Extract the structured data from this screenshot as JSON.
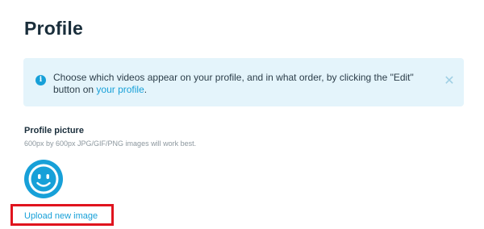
{
  "page": {
    "title": "Profile"
  },
  "banner": {
    "icon": "info-icon",
    "text": "Choose which videos appear on your profile, and in what order, by clicking the \"Edit\" button on ",
    "link_text": "your profile",
    "text_end": ".",
    "close_icon": "close-icon"
  },
  "profile_picture": {
    "heading": "Profile picture",
    "hint": "600px by 600px JPG/GIF/PNG images will work best.",
    "avatar_icon": "smiley-avatar-icon",
    "upload_label": "Upload new image"
  },
  "colors": {
    "accent": "#17a0d8",
    "banner_bg": "#e4f4fb",
    "highlight": "#e0141e",
    "title_text": "#1a2e3b",
    "muted_text": "#8c979e"
  }
}
